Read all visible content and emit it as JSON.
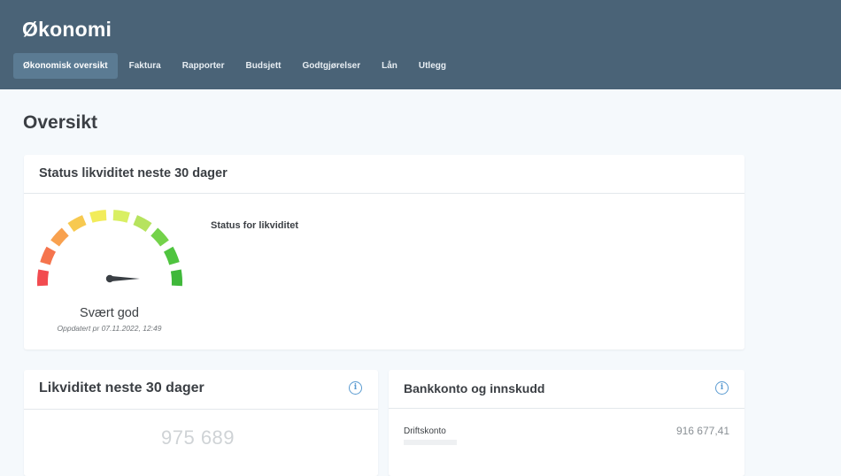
{
  "app": {
    "title": "Økonomi"
  },
  "nav": {
    "items": [
      {
        "label": "Økonomisk oversikt",
        "active": true
      },
      {
        "label": "Faktura",
        "active": false
      },
      {
        "label": "Rapporter",
        "active": false
      },
      {
        "label": "Budsjett",
        "active": false
      },
      {
        "label": "Godtgjørelser",
        "active": false
      },
      {
        "label": "Lån",
        "active": false
      },
      {
        "label": "Utlegg",
        "active": false
      }
    ]
  },
  "page": {
    "title": "Oversikt"
  },
  "status_card": {
    "title": "Status likviditet neste 30 dager",
    "gauge_label": "Svært god",
    "updated": "Oppdatert pr 07.11.2022, 12:49",
    "subtitle": "Status for likviditet",
    "gauge": {
      "segment_colors": [
        "#f24b50",
        "#f5744d",
        "#f8a14f",
        "#f7c950",
        "#f2ec5a",
        "#d9ef63",
        "#b6e35e",
        "#74d24a",
        "#4fc43f",
        "#3fb83a"
      ],
      "needle_color": "#3a3f44",
      "level": 1.0
    }
  },
  "liquidity_card": {
    "title": "Likviditet neste 30 dager",
    "value": "975 689",
    "info_icon": "info-icon"
  },
  "bank_card": {
    "title": "Bankkonto og innskudd",
    "info_icon": "info-icon",
    "accounts": [
      {
        "name": "Driftskonto",
        "amount": "916 677,41"
      }
    ]
  },
  "colors": {
    "header_bg": "#4a6377",
    "nav_active_bg": "#5b7b93",
    "page_bg": "#f5f9fc",
    "info_blue": "#5b9bd1"
  }
}
